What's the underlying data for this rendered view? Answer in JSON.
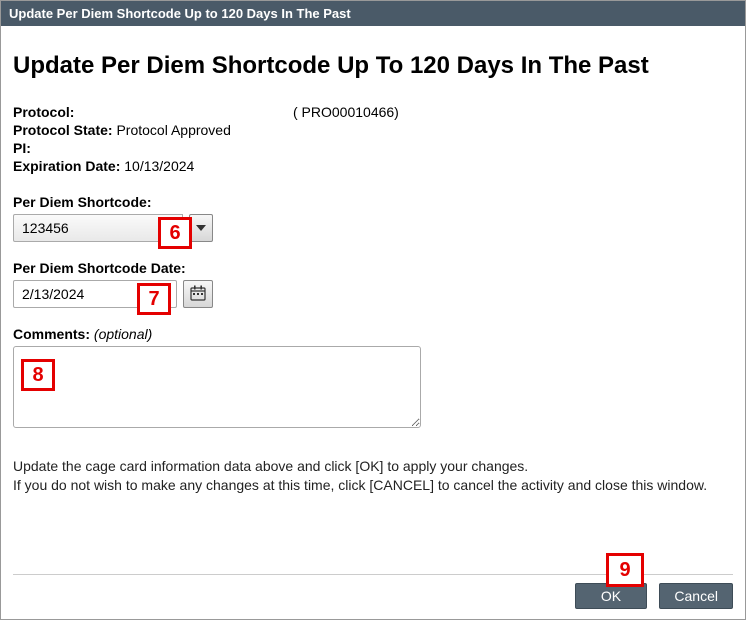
{
  "window": {
    "title": "Update Per Diem Shortcode Up to 120 Days In The Past"
  },
  "page": {
    "heading": "Update Per Diem Shortcode Up To 120 Days In The Past"
  },
  "info": {
    "protocol_label": "Protocol:",
    "protocol_value": "( PRO00010466)",
    "protocol_state_label": "Protocol State:",
    "protocol_state_value": "Protocol Approved",
    "pi_label": "PI:",
    "pi_value": "",
    "expiration_label": "Expiration Date:",
    "expiration_value": "10/13/2024"
  },
  "fields": {
    "shortcode_label": "Per Diem Shortcode:",
    "shortcode_value": "123456",
    "shortcode_date_label": "Per Diem Shortcode Date:",
    "shortcode_date_value": "2/13/2024",
    "comments_label": "Comments:",
    "comments_optional": "(optional)",
    "comments_value": ""
  },
  "help": {
    "line1": "Update the cage card information data above and click [OK] to apply your changes.",
    "line2": "If you do not wish to make any changes at this time, click [CANCEL] to cancel the activity and close this window."
  },
  "buttons": {
    "ok": "OK",
    "cancel": "Cancel"
  },
  "annotations": {
    "a6": "6",
    "a7": "7",
    "a8": "8",
    "a9": "9"
  }
}
